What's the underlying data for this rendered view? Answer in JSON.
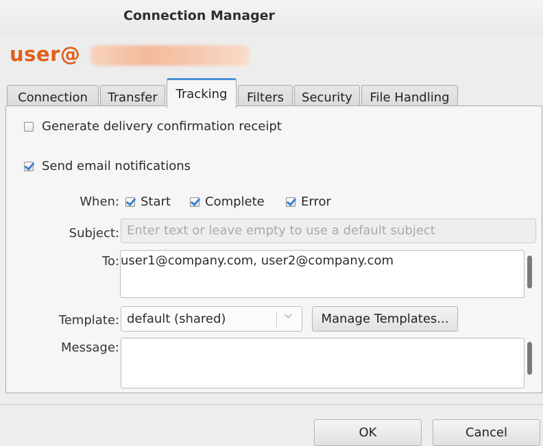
{
  "window": {
    "title": "Connection Manager"
  },
  "header": {
    "user_prefix": "user@",
    "host": ""
  },
  "tabs": [
    {
      "label": "Connection"
    },
    {
      "label": "Transfer"
    },
    {
      "label": "Tracking",
      "active": true
    },
    {
      "label": "Filters"
    },
    {
      "label": "Security"
    },
    {
      "label": "File Handling"
    }
  ],
  "tracking": {
    "delivery_receipt": {
      "label": "Generate delivery confirmation receipt",
      "checked": false
    },
    "email_notifications": {
      "label": "Send email notifications",
      "checked": true
    },
    "when": {
      "label": "When:",
      "options": [
        {
          "label": "Start",
          "checked": true
        },
        {
          "label": "Complete",
          "checked": true
        },
        {
          "label": "Error",
          "checked": true
        }
      ]
    },
    "subject": {
      "label": "Subject:",
      "value": "",
      "placeholder": "Enter text or leave empty to use a default subject"
    },
    "to": {
      "label": "To:",
      "value": "user1@company.com, user2@company.com"
    },
    "template": {
      "label": "Template:",
      "selected": "default (shared)",
      "manage_label": "Manage Templates..."
    },
    "message": {
      "label": "Message:",
      "value": ""
    }
  },
  "footer": {
    "ok_label": "OK",
    "cancel_label": "Cancel"
  },
  "colors": {
    "accent": "#4a90d9",
    "user_label": "#e0601a",
    "check": "#3d7fcf"
  }
}
